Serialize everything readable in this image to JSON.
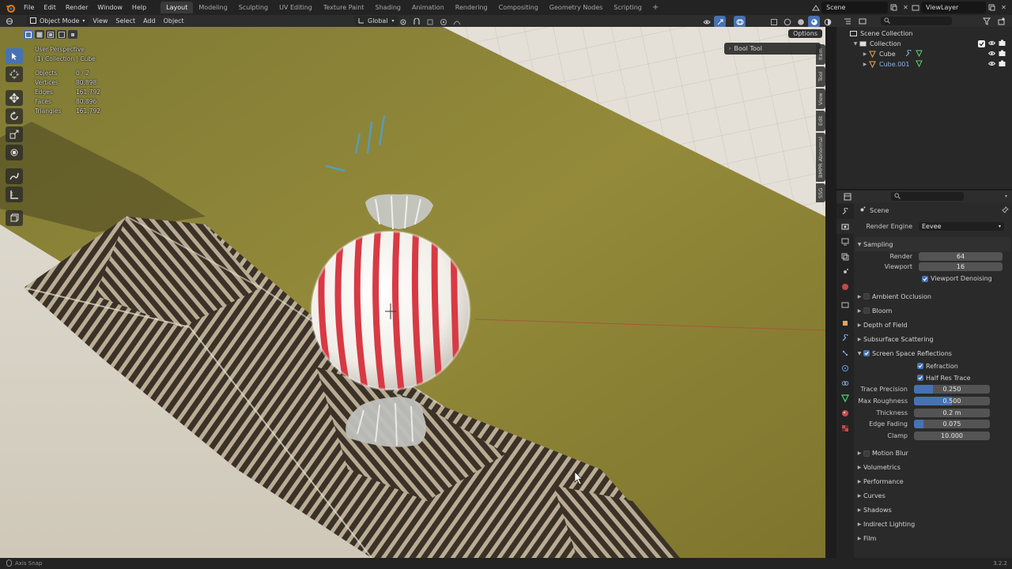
{
  "topbar": {
    "menus": [
      "File",
      "Edit",
      "Render",
      "Window",
      "Help"
    ],
    "workspaces": [
      "Layout",
      "Modeling",
      "Sculpting",
      "UV Editing",
      "Texture Paint",
      "Shading",
      "Animation",
      "Rendering",
      "Compositing",
      "Geometry Nodes",
      "Scripting"
    ],
    "active_workspace": "Layout",
    "add_workspace": "+",
    "scene": "Scene",
    "view_layer": "ViewLayer"
  },
  "viewport_header": {
    "mode": "Object Mode",
    "menus": [
      "View",
      "Select",
      "Add",
      "Object"
    ],
    "transform_orientation": "Global",
    "options": "Options"
  },
  "viewport": {
    "perspective": "User Perspective",
    "collection_path": "(1) Collection | Cube",
    "stats": [
      {
        "key": "Objects",
        "value": "0 / 2"
      },
      {
        "key": "Vertices",
        "value": "80,898"
      },
      {
        "key": "Edges",
        "value": "161,792"
      },
      {
        "key": "Faces",
        "value": "80,896"
      },
      {
        "key": "Triangles",
        "value": "161,792"
      }
    ],
    "bool_tool": "Bool Tool",
    "side_tabs": [
      "Item",
      "Tool",
      "View",
      "Edit",
      "BMPR Abnormal",
      "SSG"
    ]
  },
  "outliner": {
    "root": "Scene Collection",
    "collection": "Collection",
    "objects": [
      "Cube",
      "Cube.001"
    ]
  },
  "properties": {
    "title": "Scene",
    "render_engine_label": "Render Engine",
    "render_engine": "Eevee",
    "sampling": {
      "label": "Sampling",
      "render_label": "Render",
      "render": "64",
      "viewport_label": "Viewport",
      "viewport": "16",
      "denoise_label": "Viewport Denoising"
    },
    "sections_before": [
      "Ambient Occlusion",
      "Bloom",
      "Depth of Field",
      "Subsurface Scattering"
    ],
    "ssr": {
      "label": "Screen Space Reflections",
      "refraction": "Refraction",
      "half_res": "Half Res Trace",
      "sliders": [
        {
          "label": "Trace Precision",
          "value": "0.250",
          "fill": 0.25
        },
        {
          "label": "Max Roughness",
          "value": "0.500",
          "fill": 0.5
        },
        {
          "label": "Thickness",
          "value": "0.2 m",
          "fill": 0
        },
        {
          "label": "Edge Fading",
          "value": "0.075",
          "fill": 0.12
        },
        {
          "label": "Clamp",
          "value": "10.000",
          "fill": 0
        }
      ]
    },
    "sections_after": [
      "Motion Blur",
      "Volumetrics",
      "Performance",
      "Curves",
      "Shadows",
      "Indirect Lighting",
      "Film"
    ]
  },
  "statusbar": {
    "left": "Axis Snap",
    "version": "3.2.2"
  }
}
